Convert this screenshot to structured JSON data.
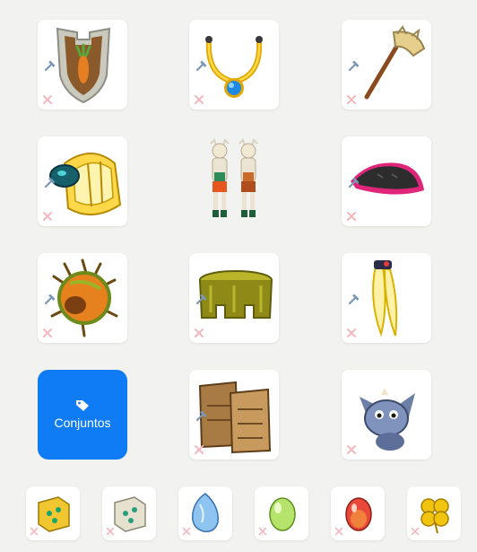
{
  "equipment": {
    "slots": [
      {
        "item": "shield-carrot",
        "modifiable": true
      },
      {
        "item": "amulet-blue-gem",
        "modifiable": true
      },
      {
        "item": "weapon-axe",
        "modifiable": true
      },
      {
        "item": "ring-gold",
        "modifiable": true
      },
      {
        "item": "character-preview",
        "modifiable": false
      },
      {
        "item": "hat-black-pink",
        "modifiable": true
      },
      {
        "item": "belt-spiky",
        "modifiable": true
      },
      {
        "item": "cloak-olive",
        "modifiable": true
      },
      {
        "item": "feather-ring",
        "modifiable": true
      },
      {
        "item": "boots-leather",
        "modifiable": true
      },
      {
        "item": "pet-blue-creature",
        "modifiable": false
      }
    ],
    "sets_button": {
      "label": "Conjuntos",
      "icon": "tag-icon",
      "color": "#0f7cf6"
    },
    "small_slots": [
      {
        "item": "dofus-gold-square"
      },
      {
        "item": "dofus-silver-square"
      },
      {
        "item": "dofus-blue"
      },
      {
        "item": "dofus-green"
      },
      {
        "item": "dofus-red"
      },
      {
        "item": "dofus-clover"
      }
    ],
    "icons": {
      "modify": "hammer-icon",
      "remove": "remove-x-icon"
    }
  }
}
